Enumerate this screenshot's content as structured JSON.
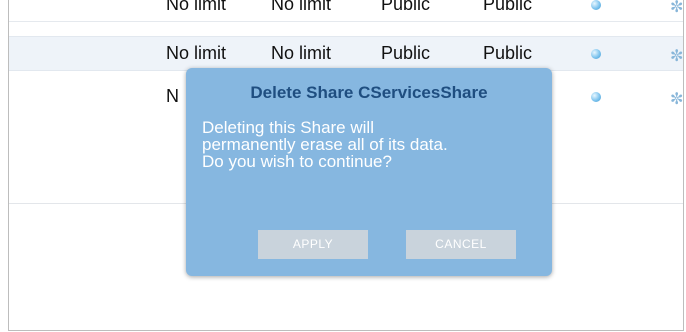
{
  "table": {
    "rows": [
      {
        "quota": "No limit",
        "limit": "No limit",
        "read_access": "Public",
        "write_access": "Public"
      },
      {
        "quota": "No limit",
        "limit": "No limit",
        "read_access": "Public",
        "write_access": "Public"
      },
      {
        "quota": "N",
        "limit": "",
        "read_access": "",
        "write_access": ""
      }
    ],
    "status_icon": "status-dot-icon",
    "edge_icon": "tools-icon"
  },
  "dialog": {
    "title": "Delete Share CServicesShare",
    "message": "Deleting this Share will\npermanently erase all of its data.\nDo you wish to continue?",
    "apply_label": "APPLY",
    "cancel_label": "CANCEL",
    "background_color": "#86b7e0",
    "title_color": "#1f4e80"
  }
}
